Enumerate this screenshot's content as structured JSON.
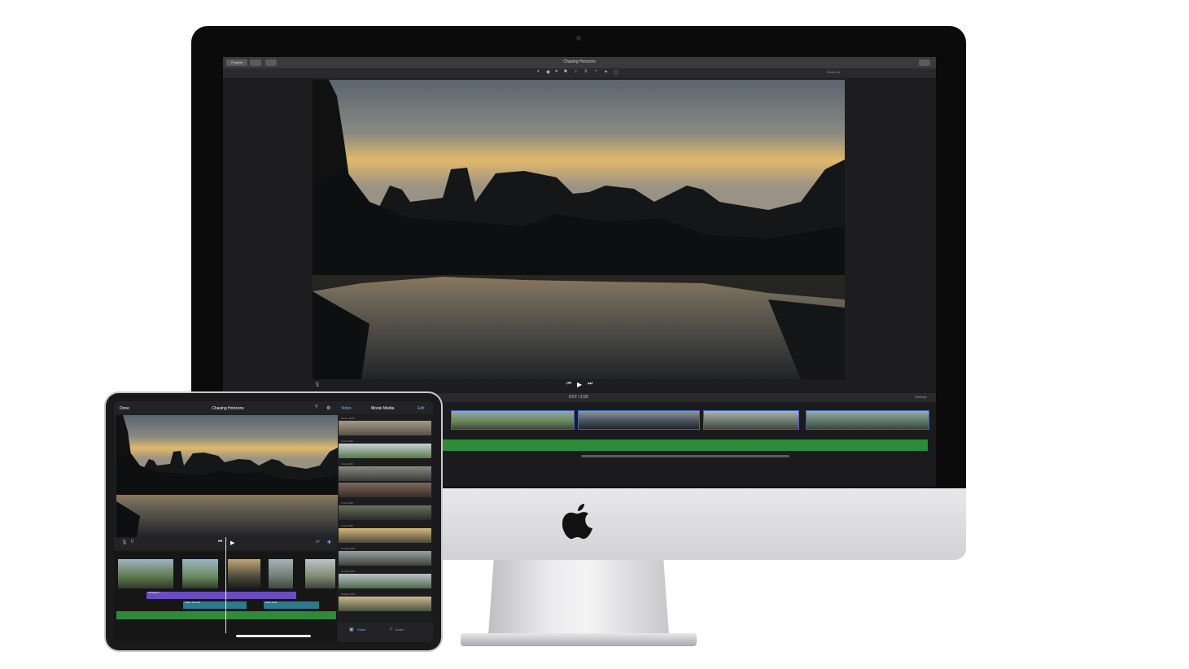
{
  "mac": {
    "buttons": [
      "Projects",
      "",
      ""
    ],
    "project_title": "Chasing Horizons",
    "toolbar_icons": [
      "color-balance-icon",
      "color-correction-icon",
      "crop-icon",
      "stabilization-icon",
      "volume-icon",
      "noise-reduction-icon",
      "speed-icon",
      "filter-icon",
      "info-icon"
    ],
    "reset_label": "Reset All",
    "timecode": "0:07 / 2:59",
    "settings_label": "Settings"
  },
  "ipad": {
    "done_label": "Done",
    "project_title": "Chasing Horizons",
    "browser_back": "Video",
    "browser_title": "Movie Media",
    "browser_edit": "Edit",
    "thumb_dates": [
      "18 Jun 2016",
      "5 Jun 2016",
      "4 Jun 2016",
      "3 Jun 2016",
      "2 Jun 2016",
      "31 May 2016",
      "30 May 2016",
      "29 May 2016"
    ],
    "audio_tracks": [
      "Narration 1",
      "Water Sounds",
      "Wind Audio"
    ],
    "tabs": {
      "video": "Video",
      "audio": "Audio"
    }
  },
  "colors": {
    "accent": "#7fb1ff",
    "audio_green": "#2e8b3a",
    "clip_blue": "#3d66b8"
  }
}
